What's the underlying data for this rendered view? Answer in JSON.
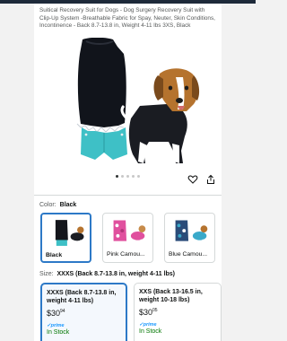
{
  "product": {
    "title": "Suitical Recovery Suit for Dogs - Dog Surgery Recovery Suit with Clip-Up System -Breathable Fabric for Spay, Neuter, Skin Conditions, Incontinence - Back 8.7-13.8 in, Weight 4-11 lbs 3XS, Black"
  },
  "gallery": {
    "image_count": 5,
    "active_index": 0,
    "heart_icon": "heart-outline-icon",
    "share_icon": "share-icon"
  },
  "color": {
    "label": "Color:",
    "selected": "Black",
    "options": [
      {
        "name": "Black",
        "selected": true,
        "swatch": "#14161c"
      },
      {
        "name": "Pink Camou...",
        "selected": false,
        "swatch": "#e0509e"
      },
      {
        "name": "Blue Camou...",
        "selected": false,
        "swatch": "#3aa9c9"
      }
    ]
  },
  "size": {
    "label": "Size:",
    "selected": "XXXS (Back 8.7-13.8 in, weight 4-11 lbs)",
    "options": [
      {
        "name": "XXXS (Back 8.7-13.8 in, weight 4-11 lbs)",
        "price_whole": "$30",
        "price_cents": "94",
        "prime": "✓prime",
        "stock": "In Stock",
        "selected": true
      },
      {
        "name": "XXS (Back 13-16.5 in, weight 10-18 lbs)",
        "price_whole": "$30",
        "price_cents": "05",
        "prime": "✓prime",
        "stock": "In Stock",
        "selected": false
      }
    ]
  },
  "colors": {
    "accent_blue": "#2d79c7",
    "in_stock_green": "#007600",
    "prime_blue": "#1a98ff",
    "suit_teal": "#3ec0c6"
  }
}
